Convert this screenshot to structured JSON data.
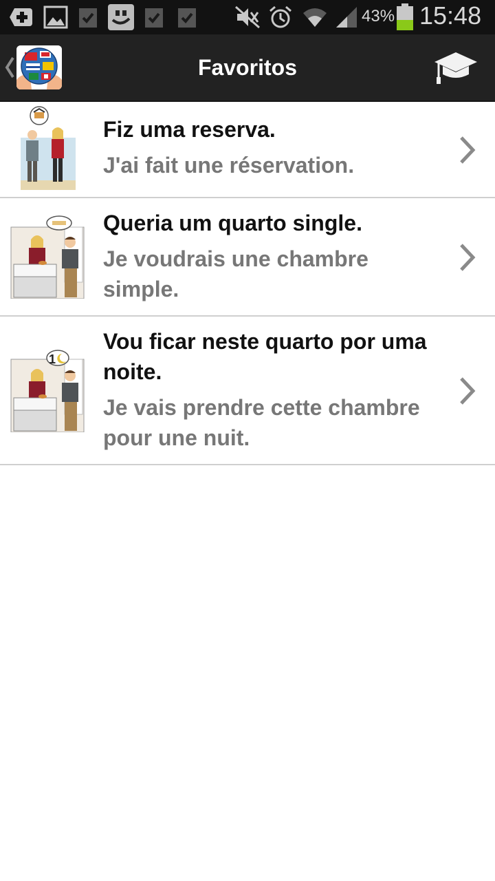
{
  "status_bar": {
    "battery_percent": "43%",
    "time": "15:48",
    "icons": [
      "add-notification-icon",
      "image-notification-icon",
      "check-notification-icon",
      "app-notification-icon",
      "check-notification-icon",
      "check-notification-icon",
      "mute-icon",
      "alarm-icon",
      "wifi-icon",
      "signal-icon",
      "battery-icon"
    ]
  },
  "action_bar": {
    "title": "Favoritos",
    "logo_icon": "globe-flags-logo",
    "action_icon": "graduation-cap-icon",
    "nav_icon": "back-chevron-icon"
  },
  "favorites": [
    {
      "portuguese": "Fiz uma reserva.",
      "french": "J'ai fait une réservation."
    },
    {
      "portuguese": "Queria um quarto single.",
      "french": "Je voudrais une chambre simple."
    },
    {
      "portuguese": "Vou ficar neste quarto por uma noite.",
      "french": "Je vais prendre cette chambre pour une nuit.",
      "bubble_number": "1"
    }
  ],
  "colors": {
    "status_bar_bg": "#121212",
    "action_bar_bg": "#222222",
    "primary_text": "#111111",
    "secondary_text": "#777777",
    "divider": "#cfcfcf",
    "battery_level": "#8ac919"
  }
}
